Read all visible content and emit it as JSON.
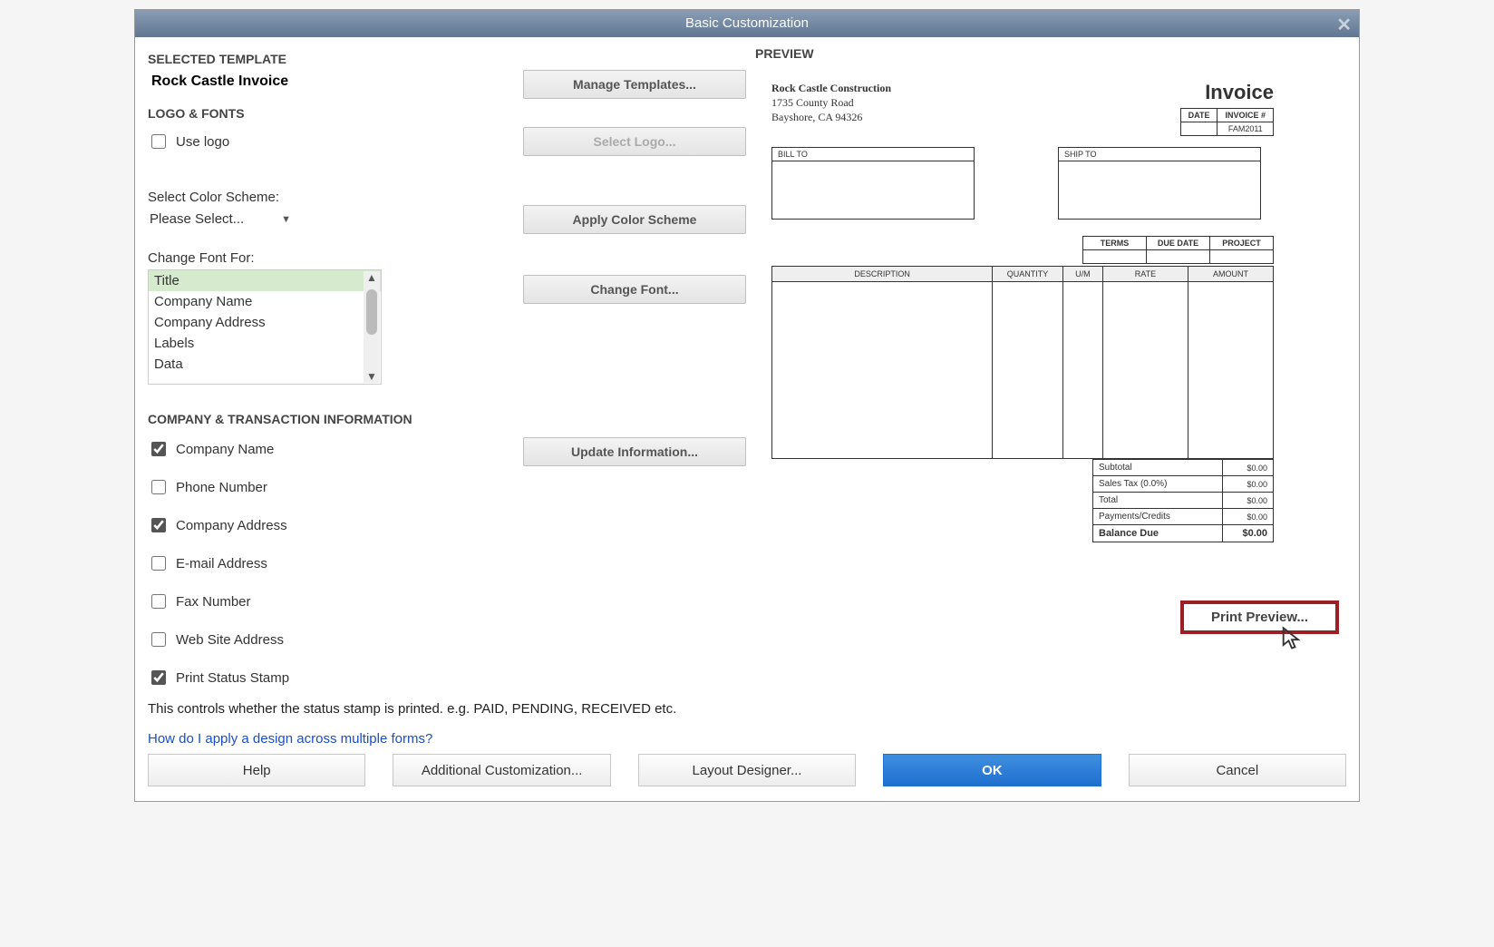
{
  "window": {
    "title": "Basic Customization"
  },
  "template": {
    "section_label": "SELECTED TEMPLATE",
    "name": "Rock Castle Invoice",
    "manage_btn": "Manage Templates..."
  },
  "logo_fonts": {
    "section_label": "LOGO & FONTS",
    "use_logo_label": "Use logo",
    "select_logo_btn": "Select Logo...",
    "color_scheme_label": "Select Color Scheme:",
    "color_scheme_value": "Please Select...",
    "apply_color_btn": "Apply Color Scheme",
    "change_font_label": "Change Font For:",
    "font_items": [
      "Title",
      "Company Name",
      "Company Address",
      "Labels",
      "Data"
    ],
    "change_font_btn": "Change Font..."
  },
  "company_info": {
    "section_label": "COMPANY & TRANSACTION INFORMATION",
    "options": {
      "company_name": "Company Name",
      "phone_number": "Phone Number",
      "company_address": "Company Address",
      "email_address": "E-mail Address",
      "fax_number": "Fax Number",
      "web_site": "Web Site Address",
      "print_status": "Print Status Stamp"
    },
    "update_btn": "Update Information...",
    "note": "This controls whether the status stamp is printed. e.g. PAID, PENDING, RECEIVED etc."
  },
  "link_text": "How do I apply a design across multiple forms?",
  "preview": {
    "section_label": "PREVIEW",
    "company_name": "Rock Castle Construction",
    "addr1": "1735 County Road",
    "addr2": "Bayshore, CA 94326",
    "doc_title": "Invoice",
    "headers": {
      "date": "DATE",
      "invoice_no": "INVOICE #",
      "invoice_no_val": "FAM2011"
    },
    "bill_to": "BILL TO",
    "ship_to": "SHIP TO",
    "term_cols": [
      "TERMS",
      "DUE DATE",
      "PROJECT"
    ],
    "line_cols": [
      "DESCRIPTION",
      "QUANTITY",
      "U/M",
      "RATE",
      "AMOUNT"
    ],
    "totals": {
      "subtotal_label": "Subtotal",
      "subtotal_val": "$0.00",
      "tax_label": "Sales Tax  (0.0%)",
      "tax_val": "$0.00",
      "total_label": "Total",
      "total_val": "$0.00",
      "payments_label": "Payments/Credits",
      "payments_val": "$0.00",
      "balance_label": "Balance Due",
      "balance_val": "$0.00"
    },
    "print_preview_btn": "Print Preview..."
  },
  "bottom": {
    "help": "Help",
    "additional": "Additional Customization...",
    "layout": "Layout Designer...",
    "ok": "OK",
    "cancel": "Cancel"
  }
}
